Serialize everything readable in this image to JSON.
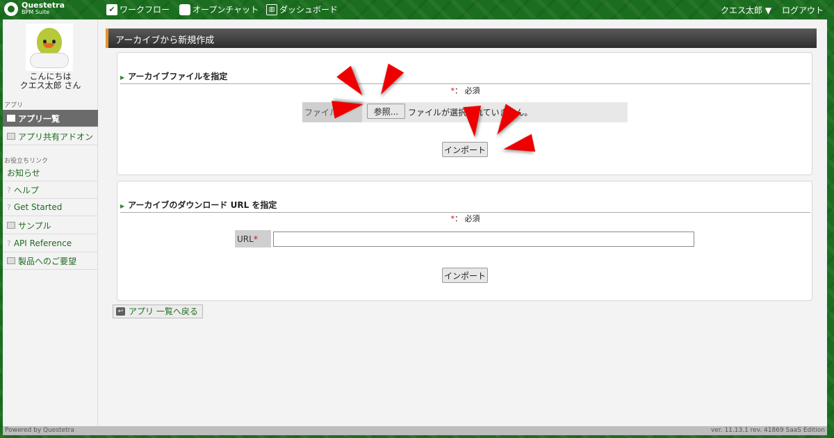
{
  "header": {
    "logo_line1": "Questetra",
    "logo_line2": "BPM Suite",
    "nav": [
      {
        "label": "ワークフロー",
        "icon": "check-icon"
      },
      {
        "label": "オープンチャット",
        "icon": "chat-bubble-icon"
      },
      {
        "label": "ダッシュボード",
        "icon": "dashboard-icon"
      }
    ],
    "user_menu": "クエス太郎 ▼",
    "logout": "ログアウト"
  },
  "sidebar": {
    "greeting_line1": "こんにちは",
    "greeting_line2": "クエス太郎 さん",
    "app_section": "アプリ",
    "app_items": [
      {
        "label": "アプリ一覧",
        "icon": "app-list-icon",
        "active": true
      },
      {
        "label": "アプリ共有アドオン",
        "icon": "addon-search-icon",
        "active": false
      }
    ],
    "links_section": "お役立ちリンク",
    "links": [
      {
        "label": "お知らせ"
      },
      {
        "label": "ヘルプ",
        "icon": "question-icon"
      },
      {
        "label": "Get Started",
        "icon": "question-icon"
      },
      {
        "label": "サンプル",
        "icon": "sample-icon"
      },
      {
        "label": "API Reference",
        "icon": "question-icon"
      },
      {
        "label": "製品へのご要望",
        "icon": "feedback-icon"
      }
    ]
  },
  "main": {
    "title": "アーカイブから新規作成",
    "archive_file": {
      "heading": "アーカイブファイルを指定",
      "required_note": "： 必須",
      "field_label": "ファイル",
      "browse_button": "参照...",
      "file_status": "ファイルが選択されていません。",
      "import_button": "インポート"
    },
    "archive_url": {
      "heading": "アーカイブのダウンロード URL を指定",
      "required_note": "： 必須",
      "field_label": "URL",
      "url_value": "",
      "import_button": "インポート"
    },
    "back_button": "アプリ 一覧へ戻る"
  },
  "footer": {
    "powered_by": "Powered by Questetra",
    "version": "ver. 11.13.1 rev. 41869 SaaS Edition"
  },
  "colors": {
    "header_bg": "#1b6e1f",
    "accent_orange": "#e8932c",
    "link_green": "#1f6b1f",
    "annotation_red": "#e00000"
  }
}
